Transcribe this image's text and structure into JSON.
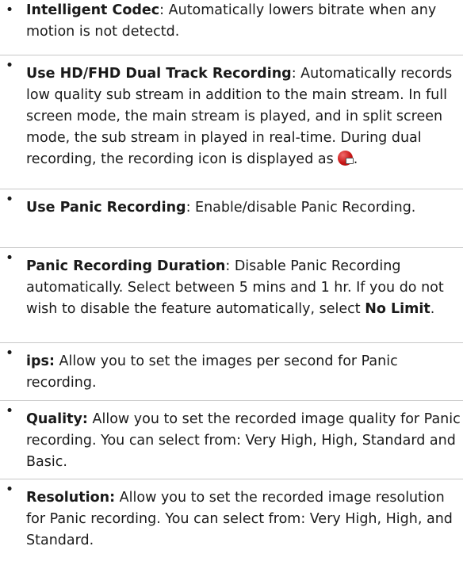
{
  "items": [
    {
      "term": "Intelligent Codec",
      "sep": ": ",
      "text": "Automatically lowers bitrate when any motion is not detectd."
    },
    {
      "term": "Use HD/FHD Dual Track Recording",
      "sep": ": ",
      "text": "Automatically records low quality sub stream in addition to the main stream. In full screen mode, the main stream is played, and in split screen mode, the sub stream in played in real-time. During dual recording, the recording icon is displayed as",
      "icon": "dual-recording-icon",
      "text_after": "."
    },
    {
      "term": "Use Panic Recording",
      "sep": ": ",
      "text": "Enable/disable Panic Recording."
    },
    {
      "term": "Panic Recording Duration",
      "sep": ": ",
      "text": "Disable Panic Recording automatically. Select between 5 mins and 1 hr. If you do not wish to disable the feature automatically, select",
      "term2": "No Limit",
      "text_after": "."
    },
    {
      "term": "ips:",
      "sep": " ",
      "text": "Allow you to set the images per second for Panic recording."
    },
    {
      "term": "Quality:",
      "sep": " ",
      "text": "Allow you to set the recorded image quality for Panic recording. You can select from: Very High, High, Standard and Basic."
    },
    {
      "term": "Resolution:",
      "sep": " ",
      "text": "Allow you to set the recorded image resolution for Panic recording. You can select from: Very High, High, and Standard."
    }
  ],
  "bullet": "•",
  "colors": {
    "text": "#1a1a1a",
    "divider": "#c8c8c8",
    "icon": "#c81414"
  }
}
